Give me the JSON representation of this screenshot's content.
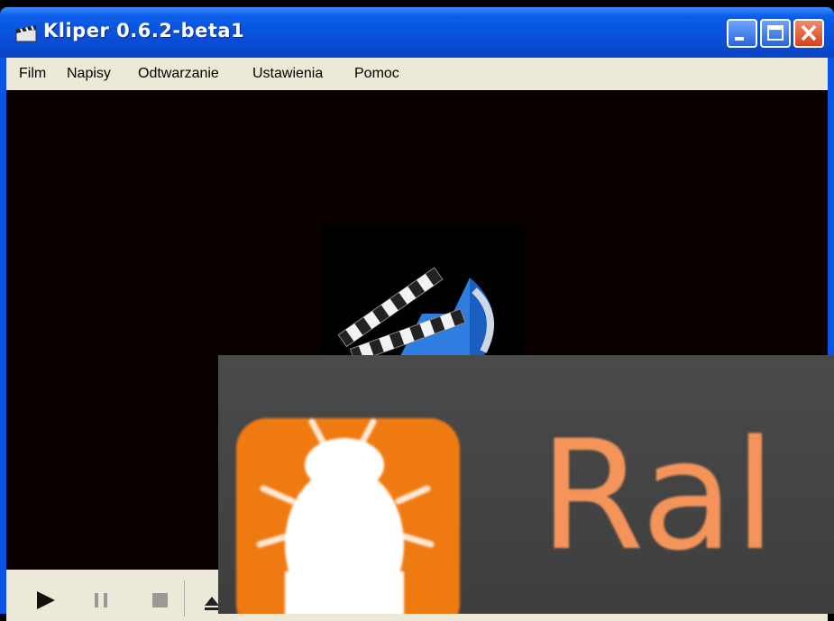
{
  "window": {
    "title": "Kliper 0.6.2-beta1",
    "buttons": {
      "minimize": "minimize-icon",
      "maximize": "maximize-icon",
      "close": "close-icon"
    }
  },
  "menu": {
    "items": [
      "Film",
      "Napisy",
      "Odtwarzanie",
      "Ustawienia",
      "Pomoc"
    ]
  },
  "video": {
    "logo": "clapperboard-speaker-logo"
  },
  "controls": {
    "icons": [
      "play-icon",
      "pause-icon",
      "stop-icon",
      "eject-icon"
    ]
  },
  "overlay": {
    "app_icon": "fly-icon",
    "brand_text": "Ral",
    "colors": {
      "tile": "#f07a12",
      "text": "#f4945a",
      "background": "#454545"
    }
  }
}
